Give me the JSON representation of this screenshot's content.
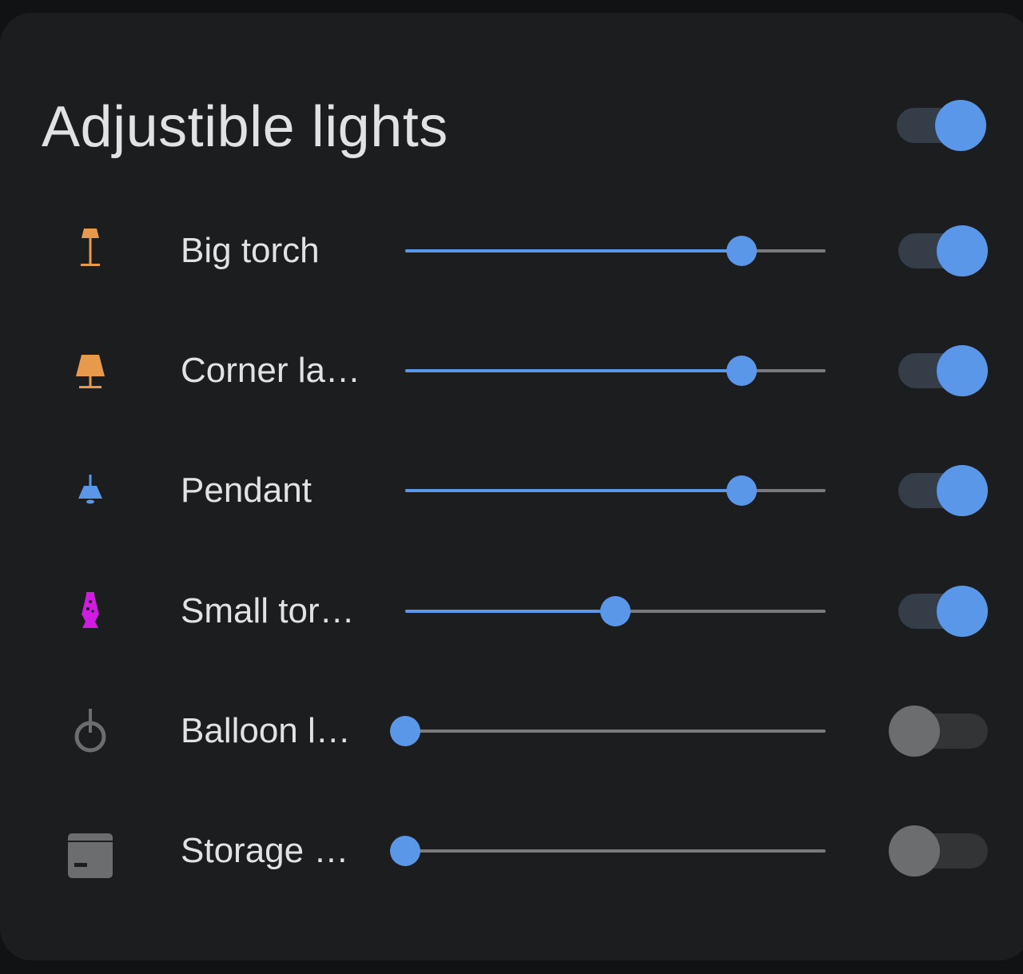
{
  "card": {
    "title": "Adjustible lights",
    "master_on": true
  },
  "colors": {
    "accent": "#5b97e8",
    "background": "#1c1d1f",
    "text": "#e1e2e3"
  },
  "lights": [
    {
      "label": "Big torch",
      "icon": "floor-lamp-icon",
      "icon_color": "#e89a4c",
      "brightness": 0.8,
      "on": true
    },
    {
      "label": "Corner la…",
      "icon": "table-lamp-icon",
      "icon_color": "#e89a4c",
      "brightness": 0.8,
      "on": true
    },
    {
      "label": "Pendant",
      "icon": "ceiling-light-icon",
      "icon_color": "#5b97e8",
      "brightness": 0.8,
      "on": true
    },
    {
      "label": "Small tor…",
      "icon": "lava-lamp-icon",
      "icon_color": "#d01ce0",
      "brightness": 0.5,
      "on": true
    },
    {
      "label": "Balloon l…",
      "icon": "pendant-ring-icon",
      "icon_color": "#6c6d6e",
      "brightness": 0.0,
      "on": false
    },
    {
      "label": "Storage …",
      "icon": "storage-box-icon",
      "icon_color": "#6c6d6e",
      "brightness": 0.0,
      "on": false
    }
  ]
}
